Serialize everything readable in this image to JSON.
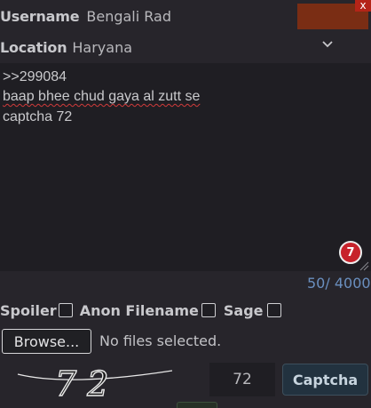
{
  "form": {
    "username_label": "Username",
    "username_value": "Bengali Rad",
    "close_label": "x",
    "location_label": "Location",
    "location_value": "Haryana",
    "message_lines": [
      ">>299084",
      "baap bhee chud gaya al zutt se",
      "captcha 72"
    ],
    "badge_count": "7",
    "char_counter": "50/ 4000",
    "options": {
      "spoiler": "Spoiler",
      "anon_filename": "Anon Filename",
      "sage": "Sage"
    },
    "browse_label": "Browse...",
    "no_file_text": "No files selected.",
    "captcha_text": "7 2",
    "captcha_value": "72",
    "captcha_button": "Captcha"
  },
  "colors": {
    "background": "#27252b",
    "swatch": "#7a2d14",
    "badge": "#c7222b",
    "counter": "#6a8fbf"
  },
  "icons": [
    "chevron-down-icon",
    "close-icon",
    "resize-grip-icon"
  ]
}
